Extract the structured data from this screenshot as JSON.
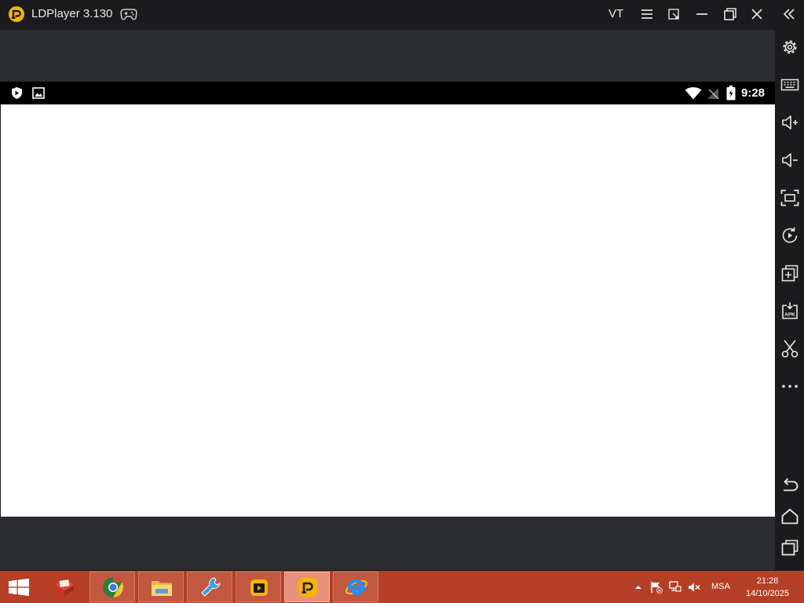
{
  "window": {
    "title": "LDPlayer 3.130",
    "vt_label": "VT",
    "controls": [
      "menu-icon",
      "resize-icon",
      "minimize-icon",
      "restore-icon",
      "close-icon",
      "collapse-sidebar-icon"
    ]
  },
  "toolbar": {
    "items": [
      "settings-icon",
      "keyboard-icon",
      "volume-up-icon",
      "volume-down-icon",
      "fullscreen-icon",
      "rotate-icon",
      "multi-instance-icon",
      "apk-install-icon",
      "screenshot-icon",
      "more-icon"
    ],
    "nav": [
      "back-icon",
      "home-icon",
      "recent-apps-icon"
    ]
  },
  "android": {
    "status_time": "9:28",
    "status_icons": [
      "shield-icon",
      "image-icon",
      "wifi-icon",
      "no-signal-icon",
      "battery-charging-icon"
    ]
  },
  "taskbar": {
    "apps": [
      "folder-red-icon",
      "chrome-icon",
      "file-explorer-icon",
      "tool-icon",
      "ld-store-icon",
      "ldplayer-icon",
      "internet-explorer-icon"
    ],
    "tray_language": "MSA",
    "clock_time": "21:28",
    "clock_date": "14/10/2025"
  },
  "colors": {
    "title_bar": "#1b1b1d",
    "emulator_frame": "#2b2c30",
    "taskbar": "#b53f26",
    "accent": "#f5b400"
  }
}
